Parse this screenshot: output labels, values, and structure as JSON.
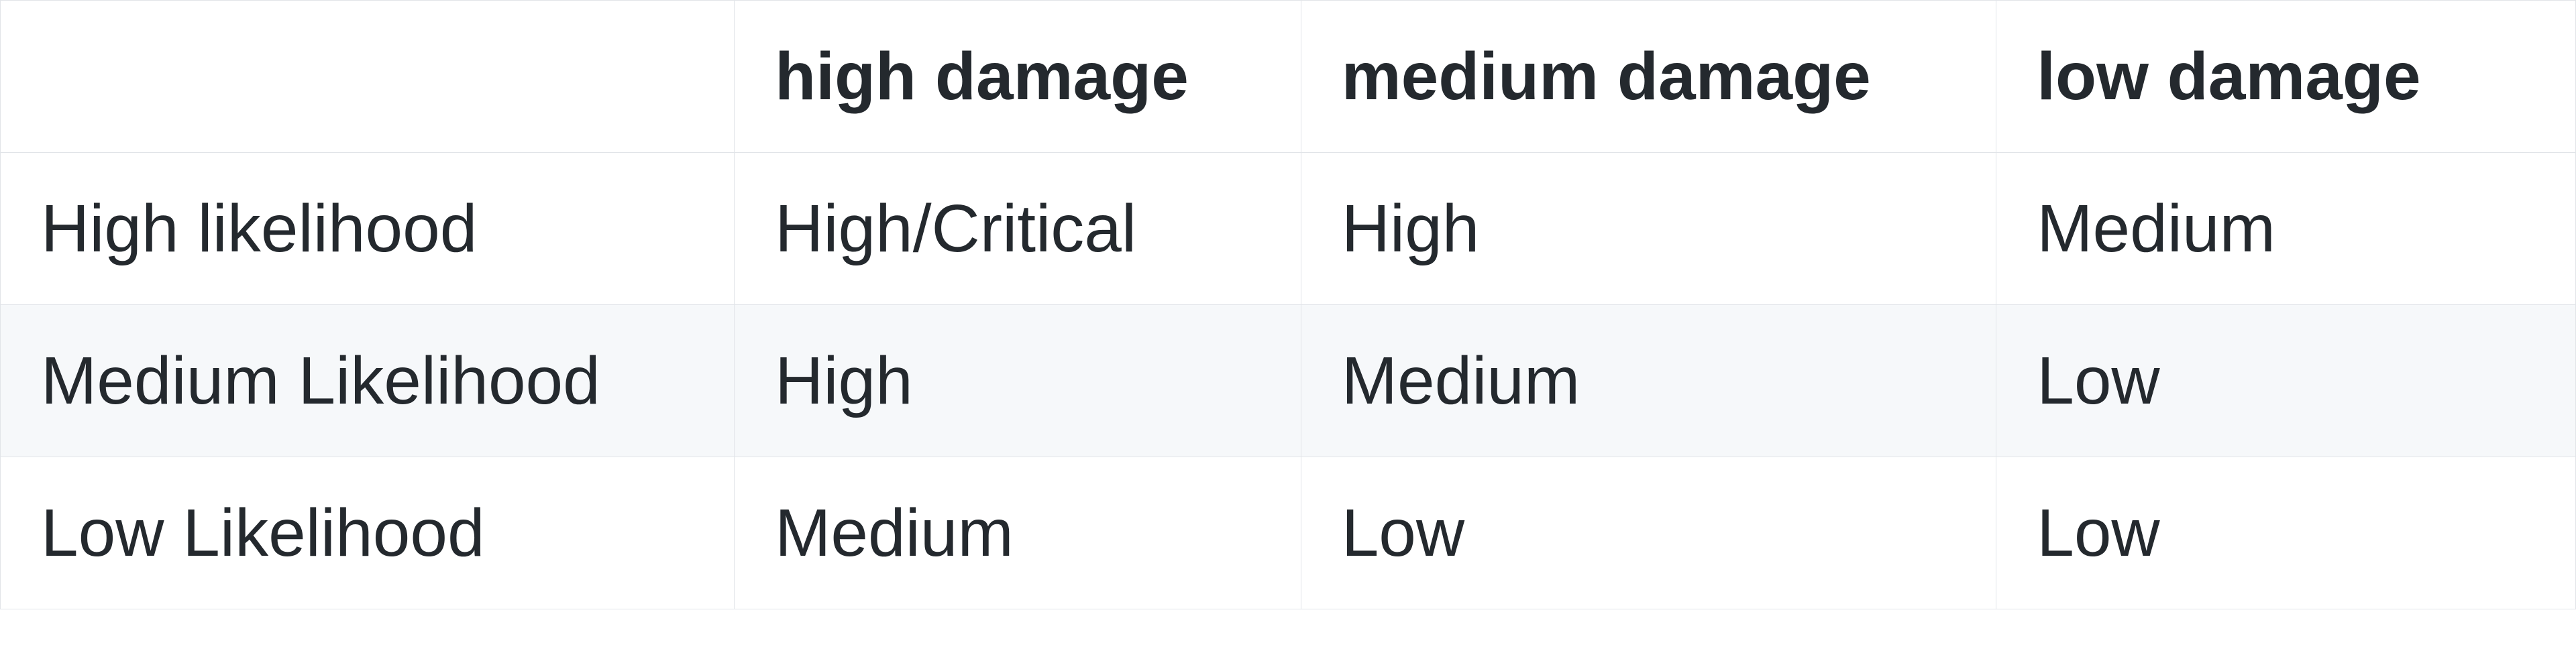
{
  "table": {
    "corner": "",
    "columns": [
      "high damage",
      "medium damage",
      "low damage"
    ],
    "rows": [
      {
        "label": "High likelihood",
        "cells": [
          "High/Critical",
          "High",
          "Medium"
        ]
      },
      {
        "label": "Medium Likelihood",
        "cells": [
          "High",
          "Medium",
          "Low"
        ]
      },
      {
        "label": "Low Likelihood",
        "cells": [
          "Medium",
          "Low",
          "Low"
        ]
      }
    ]
  },
  "chart_data": {
    "type": "table",
    "title": "",
    "columns": [
      "",
      "high damage",
      "medium damage",
      "low damage"
    ],
    "rows": [
      [
        "High likelihood",
        "High/Critical",
        "High",
        "Medium"
      ],
      [
        "Medium Likelihood",
        "High",
        "Medium",
        "Low"
      ],
      [
        "Low Likelihood",
        "Medium",
        "Low",
        "Low"
      ]
    ]
  }
}
